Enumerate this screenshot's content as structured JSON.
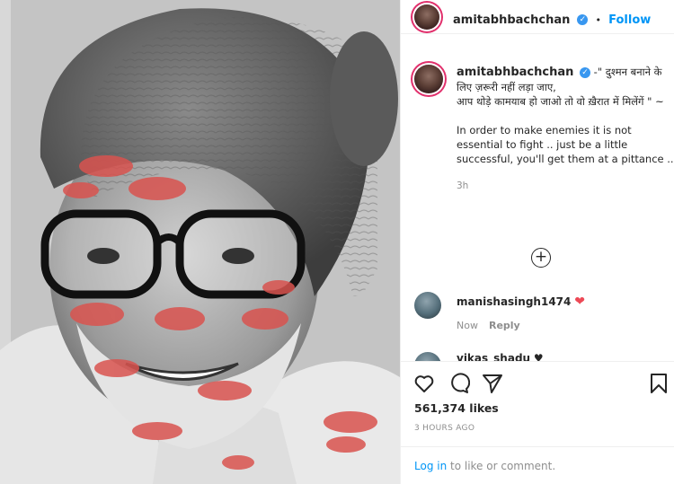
{
  "post": {
    "username": "amitabhbachchan",
    "follow_label": "Follow",
    "follow_separator": "•",
    "verified": true,
    "caption_hindi_line1": "-\" दुश्मन बनाने के लिए ज़रूरी नहीं लड़ा जाए,",
    "caption_hindi_line2": "आप थोड़े कामयाब हो जाओ तो वो ख़ैरात में मिलेंगें \" ~",
    "caption_english": "In order to make enemies it is not essential to fight .. just be a little successful, you'll get them at a pittance ..",
    "caption_time": "3h",
    "likes": "561,374 likes",
    "posted_ago": "3 HOURS AGO"
  },
  "comments": [
    {
      "username": "manishasingh1474",
      "reaction": "❤",
      "time": "Now",
      "reply_label": "Reply"
    },
    {
      "username": "vikas_shadu",
      "reaction": "♥"
    }
  ],
  "login": {
    "link": "Log in",
    "rest": " to like or comment."
  },
  "colors": {
    "accent": "#0095f6",
    "heart": "#ed4956",
    "muted": "#8e8e8e"
  },
  "icons": {
    "like": "heart-outline-icon",
    "comment": "speech-bubble-icon",
    "share": "paper-plane-icon",
    "save": "bookmark-icon",
    "load_more": "plus-circle-icon"
  }
}
